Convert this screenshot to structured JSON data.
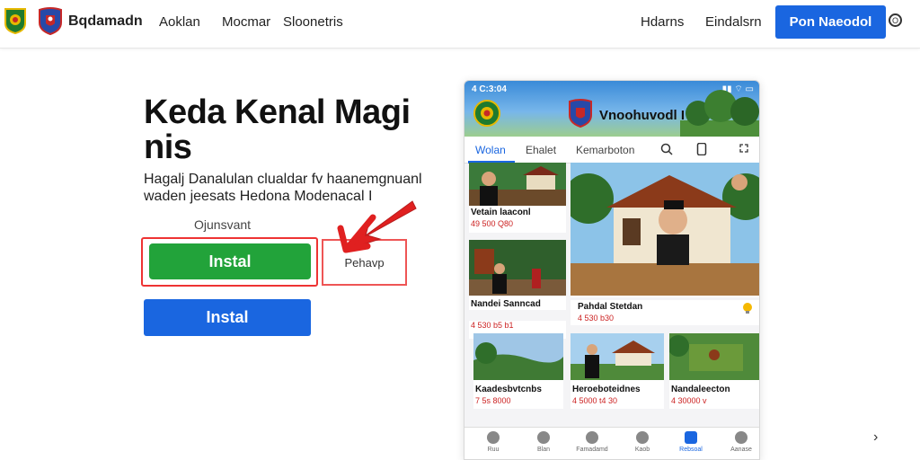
{
  "nav": {
    "brand": "Bqdamadn",
    "links": [
      "Aoklan",
      "Mocmar",
      "Sloonetris"
    ],
    "right_links": [
      "Hdarns",
      "Eindalsrn"
    ],
    "cta": "Pon Naeodol",
    "circle_icon": "O"
  },
  "hero": {
    "title_line1": "Keda Kenal Magi",
    "title_line2": "nis",
    "desc_line1": "Hagalj Danalulan clualdar fv haanemgnuanl",
    "desc_line2": "waden jeesats Hedona Modenacal I",
    "note": "Ojunsvant",
    "install_green": "Instal",
    "outline_button": "Pehavp",
    "install_blue": "Instal",
    "colors": {
      "green": "#22a33a",
      "blue": "#1a66e0",
      "highlight": "#e33333"
    }
  },
  "phone": {
    "status_time": "4 C:3:04",
    "status_icons": "▮▮ ⌔ ▭",
    "title": "Vnoohuvodl I",
    "tabs": [
      "Wolan",
      "Ehalet",
      "Kemarboton"
    ],
    "cards": [
      {
        "caption": "Vetain laaconl",
        "meta": "49 500 Q80"
      },
      {
        "caption": "Nandei Sanncad",
        "meta": "4 530 b5 b1"
      },
      {
        "caption": "Pahdal Stetdan",
        "meta": "4 530 b30"
      },
      {
        "caption": "Kaadesbvtcnbs",
        "meta": "7 5s 8000"
      },
      {
        "caption": "Heroeboteidnes",
        "meta": "4 5000 t4 30"
      },
      {
        "caption": "Nandaleecton",
        "meta": "4 30000 v"
      }
    ],
    "bottom_nav": [
      "Ruu",
      "Blan",
      "Famadamd",
      "Kaob",
      "Rebsoal",
      "Aanase"
    ]
  }
}
